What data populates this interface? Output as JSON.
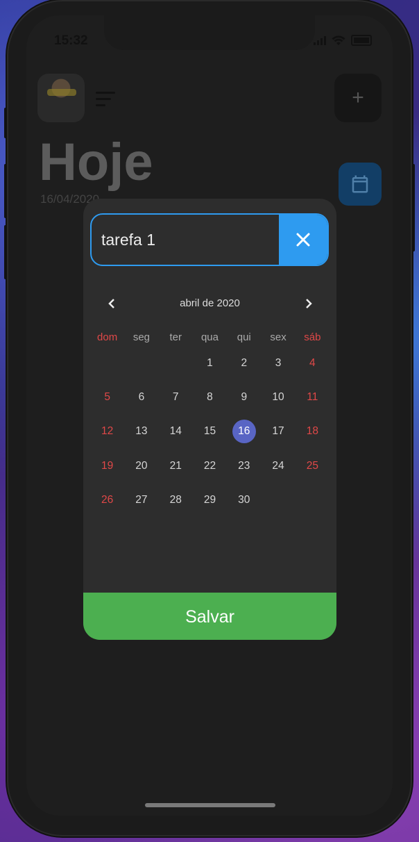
{
  "status_bar": {
    "time": "15:32"
  },
  "header": {
    "title": "Hoje",
    "date": "16/04/2020",
    "add_label": "+"
  },
  "icons": {
    "menu": "menu-icon",
    "add": "plus-icon",
    "calendar": "calendar-icon",
    "clear": "close-icon",
    "prev": "chevron-left-icon",
    "next": "chevron-right-icon"
  },
  "colors": {
    "accent_blue": "#2e9bf0",
    "save_green": "#4caf50",
    "weekend_red": "#e04848",
    "selected_day": "#5965c4"
  },
  "modal": {
    "task_value": "tarefa 1",
    "month_label": "abril de 2020",
    "weekdays": [
      "dom",
      "seg",
      "ter",
      "qua",
      "qui",
      "sex",
      "sáb"
    ],
    "weeks": [
      [
        "",
        "",
        "",
        "1",
        "2",
        "3",
        "4"
      ],
      [
        "5",
        "6",
        "7",
        "8",
        "9",
        "10",
        "11"
      ],
      [
        "12",
        "13",
        "14",
        "15",
        "16",
        "17",
        "18"
      ],
      [
        "19",
        "20",
        "21",
        "22",
        "23",
        "24",
        "25"
      ],
      [
        "26",
        "27",
        "28",
        "29",
        "30",
        "",
        ""
      ]
    ],
    "selected_day": "16",
    "save_label": "Salvar"
  }
}
